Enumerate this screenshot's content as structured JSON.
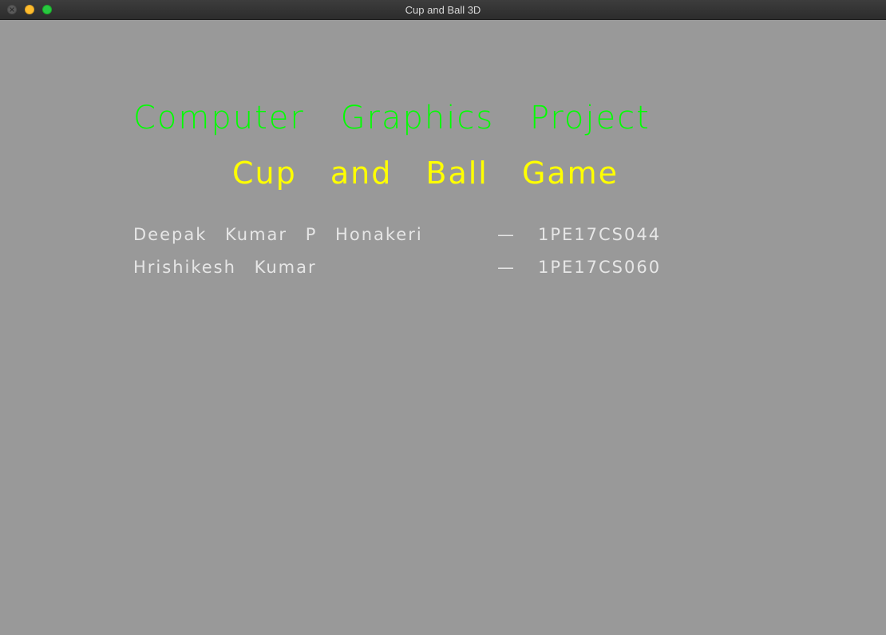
{
  "window": {
    "title": "Cup and Ball 3D"
  },
  "colors": {
    "background": "#999999",
    "heading": "#00ff00",
    "subheading": "#ffff00",
    "credits": "#e6e6e6"
  },
  "splash": {
    "heading": "Computer Graphics Project",
    "subheading": "Cup and Ball Game",
    "credits": [
      {
        "name": "Deepak Kumar P Honakeri",
        "separator": "—",
        "usn": "1PE17CS044"
      },
      {
        "name": "Hrishikesh Kumar",
        "separator": "—",
        "usn": "1PE17CS060"
      }
    ]
  }
}
